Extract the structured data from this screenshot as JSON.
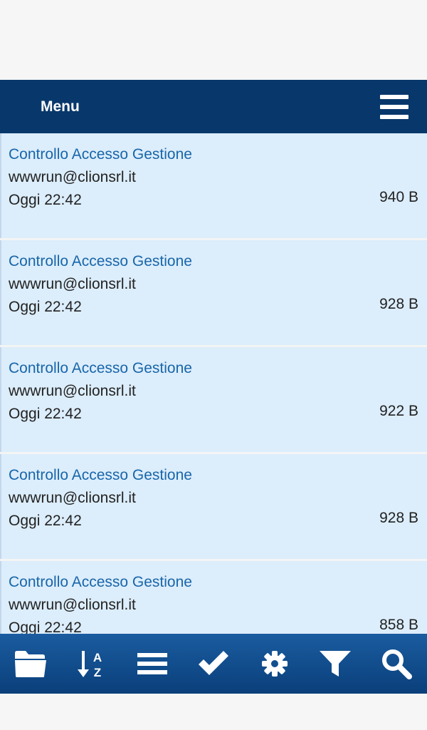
{
  "header": {
    "title": "Menu"
  },
  "list": {
    "items": [
      {
        "title": "Controllo Accesso Gestione",
        "email": "wwwrun@clionsrl.it",
        "date": "Oggi 22:42",
        "size": "940 B"
      },
      {
        "title": "Controllo Accesso Gestione",
        "email": "wwwrun@clionsrl.it",
        "date": "Oggi 22:42",
        "size": "928 B"
      },
      {
        "title": "Controllo Accesso Gestione",
        "email": "wwwrun@clionsrl.it",
        "date": "Oggi 22:42",
        "size": "922 B"
      },
      {
        "title": "Controllo Accesso Gestione",
        "email": "wwwrun@clionsrl.it",
        "date": "Oggi 22:42",
        "size": "928 B"
      },
      {
        "title": "Controllo Accesso Gestione",
        "email": "wwwrun@clionsrl.it",
        "date": "Oggi 22:42",
        "size": "858 B"
      }
    ]
  },
  "toolbar": {
    "icons": [
      "folder-icon",
      "sort-az-icon",
      "list-icon",
      "checkmark-icon",
      "gear-icon",
      "filter-icon",
      "search-icon"
    ],
    "sort_letter_a": "A",
    "sort_letter_z": "Z"
  },
  "colors": {
    "header_bg": "#08386b",
    "toolbar_bg": "#0f4b8c",
    "item_bg": "#dcedfb",
    "title_color": "#1866aa"
  }
}
